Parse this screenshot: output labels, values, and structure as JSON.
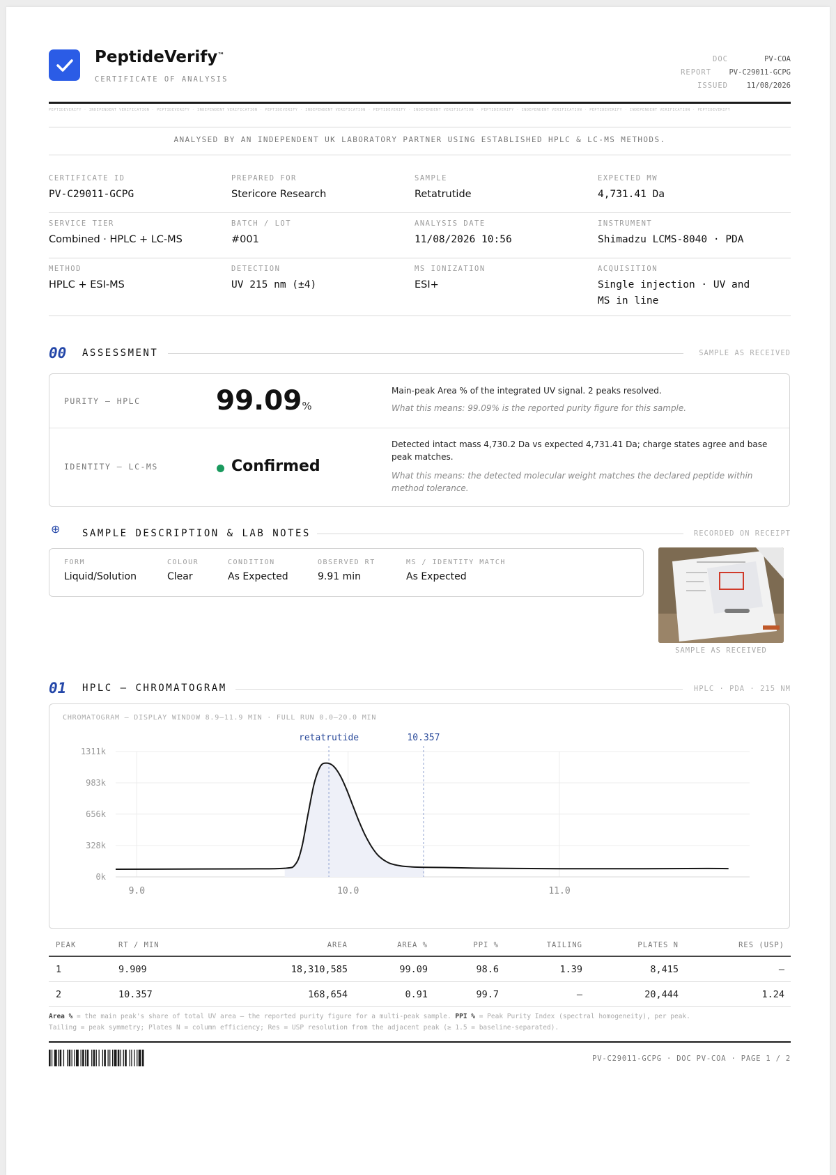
{
  "header": {
    "brand_name": "PeptideVerify",
    "brand_tm": "™",
    "brand_subtitle": "CERTIFICATE OF ANALYSIS",
    "meta": [
      {
        "label": "DOC",
        "value": "PV-COA"
      },
      {
        "label": "REPORT",
        "value": "PV-C29011-GCPG"
      },
      {
        "label": "ISSUED",
        "value": "11/08/2026"
      }
    ],
    "microtext": "PEPTIDEVERIFY · INDEPENDENT VERIFICATION · PEPTIDEVERIFY · INDEPENDENT VERIFICATION · PEPTIDEVERIFY · INDEPENDENT VERIFICATION · PEPTIDEVERIFY · INDEPENDENT VERIFICATION · PEPTIDEVERIFY · INDEPENDENT VERIFICATION · PEPTIDEVERIFY · INDEPENDENT VERIFICATION · PEPTIDEVERIFY"
  },
  "banner": "ANALYSED BY AN INDEPENDENT UK LABORATORY PARTNER USING ESTABLISHED HPLC & LC-MS METHODS.",
  "info": {
    "certificate_id": {
      "label": "CERTIFICATE ID",
      "value": "PV-C29011-GCPG"
    },
    "prepared_for": {
      "label": "PREPARED FOR",
      "value": "Stericore Research"
    },
    "sample": {
      "label": "SAMPLE",
      "value": "Retatrutide"
    },
    "expected_mw": {
      "label": "EXPECTED MW",
      "value": "4,731.41 Da"
    },
    "service_tier": {
      "label": "SERVICE TIER",
      "value": "Combined · HPLC + LC-MS"
    },
    "batch_lot": {
      "label": "BATCH / LOT",
      "value": "#001"
    },
    "analysis_date": {
      "label": "ANALYSIS DATE",
      "value": "11/08/2026 10:56"
    },
    "instrument": {
      "label": "INSTRUMENT",
      "value": "Shimadzu LCMS-8040 · PDA"
    },
    "method": {
      "label": "METHOD",
      "value": "HPLC + ESI-MS"
    },
    "detection": {
      "label": "DETECTION",
      "value": "UV 215 nm (±4)"
    },
    "ms_ionization": {
      "label": "MS IONIZATION",
      "value": "ESI+"
    },
    "acquisition": {
      "label": "ACQUISITION",
      "value_line1": "Single injection · UV and",
      "value_line2": "MS in line"
    }
  },
  "assessment": {
    "number": "00",
    "title": "ASSESSMENT",
    "tag": "SAMPLE AS RECEIVED",
    "purity": {
      "label": "PURITY — HPLC",
      "value": "99.09",
      "unit": "%",
      "desc": "Main-peak Area % of the integrated UV signal. 2 peaks resolved.",
      "meaning": "What this means: 99.09% is the reported purity figure for this sample."
    },
    "identity": {
      "label": "IDENTITY — LC-MS",
      "value": "Confirmed",
      "status_color": "#1a9a5e",
      "desc_line1": "Detected intact mass 4,730.2 Da vs expected 4,731.41 Da; charge states agree and base",
      "desc_line2": "peak matches.",
      "meaning_line1": "What this means: the detected molecular weight matches the declared peptide within",
      "meaning_line2": "method tolerance."
    }
  },
  "sample_desc": {
    "icon_glyph": "⊕",
    "title": "SAMPLE DESCRIPTION & LAB NOTES",
    "tag": "RECORDED ON RECEIPT",
    "fields": [
      {
        "label": "FORM",
        "value": "Liquid/Solution"
      },
      {
        "label": "COLOUR",
        "value": "Clear"
      },
      {
        "label": "CONDITION",
        "value": "As Expected"
      },
      {
        "label": "OBSERVED RT",
        "value": "9.91 min"
      },
      {
        "label": "MS / IDENTITY MATCH",
        "value": "As Expected"
      }
    ],
    "photo_caption": "SAMPLE AS RECEIVED"
  },
  "hplc": {
    "number": "01",
    "title": "HPLC — CHROMATOGRAM",
    "tag": "HPLC · PDA · 215 NM",
    "chart_caption": "CHROMATOGRAM — DISPLAY WINDOW 8.9–11.9 MIN · FULL RUN 0.0–20.0 MIN",
    "table": {
      "headers": [
        "PEAK",
        "RT / MIN",
        "AREA",
        "AREA %",
        "PPI %",
        "TAILING",
        "PLATES N",
        "RES (USP)"
      ],
      "rows": [
        [
          "1",
          "9.909",
          "18,310,585",
          "99.09",
          "98.6",
          "1.39",
          "8,415",
          "–"
        ],
        [
          "2",
          "10.357",
          "168,654",
          "0.91",
          "99.7",
          "–",
          "20,444",
          "1.24"
        ]
      ]
    },
    "footnote_line1_bold1": "Area %",
    "footnote_line1_text1": " = the main peak's share of total UV area — the reported purity figure for a multi-peak sample. ",
    "footnote_line1_bold2": "PPI %",
    "footnote_line1_text2": " = Peak Purity Index (spectral homogeneity), per peak.",
    "footnote_line2": "Tailing = peak symmetry; Plates N = column efficiency; Res = USP resolution from the adjacent peak (≥ 1.5 = baseline-separated)."
  },
  "footer": {
    "text": "PV-C29011-GCPG · DOC PV-COA · PAGE 1 / 2"
  },
  "colors": {
    "accent": "#2b5ce6",
    "section_number": "#2346a8",
    "peak_label": "#2a4a9a"
  },
  "chart_data": {
    "type": "line",
    "title": "",
    "xlabel": "",
    "ylabel": "",
    "xlim": [
      8.9,
      11.9
    ],
    "ylim": [
      0,
      1311
    ],
    "x_ticks": [
      9.0,
      10.0,
      11.0
    ],
    "x_tick_labels": [
      "9.0",
      "10.0",
      "11.0"
    ],
    "y_ticks": [
      0,
      328,
      656,
      983,
      1311
    ],
    "y_tick_labels": [
      "0k",
      "328k",
      "656k",
      "983k",
      "1311k"
    ],
    "grid": true,
    "series": [
      {
        "x": [
          8.9,
          9.2,
          9.5,
          9.7,
          9.75,
          9.78,
          9.81,
          9.84,
          9.87,
          9.9,
          9.93,
          9.96,
          9.99,
          10.02,
          10.05,
          10.08,
          10.11,
          10.14,
          10.17,
          10.2,
          10.25,
          10.3,
          10.36,
          10.45,
          10.6,
          10.8,
          11.1,
          11.4,
          11.7,
          11.8
        ],
        "values": [
          80,
          82,
          84,
          90,
          130,
          300,
          650,
          980,
          1160,
          1190,
          1160,
          1070,
          930,
          760,
          590,
          440,
          320,
          230,
          175,
          140,
          115,
          105,
          100,
          98,
          92,
          88,
          85,
          86,
          88,
          87
        ]
      }
    ],
    "annotations": [
      {
        "x": 9.909,
        "label": "retatrutide"
      },
      {
        "x": 10.357,
        "label": "10.357"
      }
    ]
  }
}
